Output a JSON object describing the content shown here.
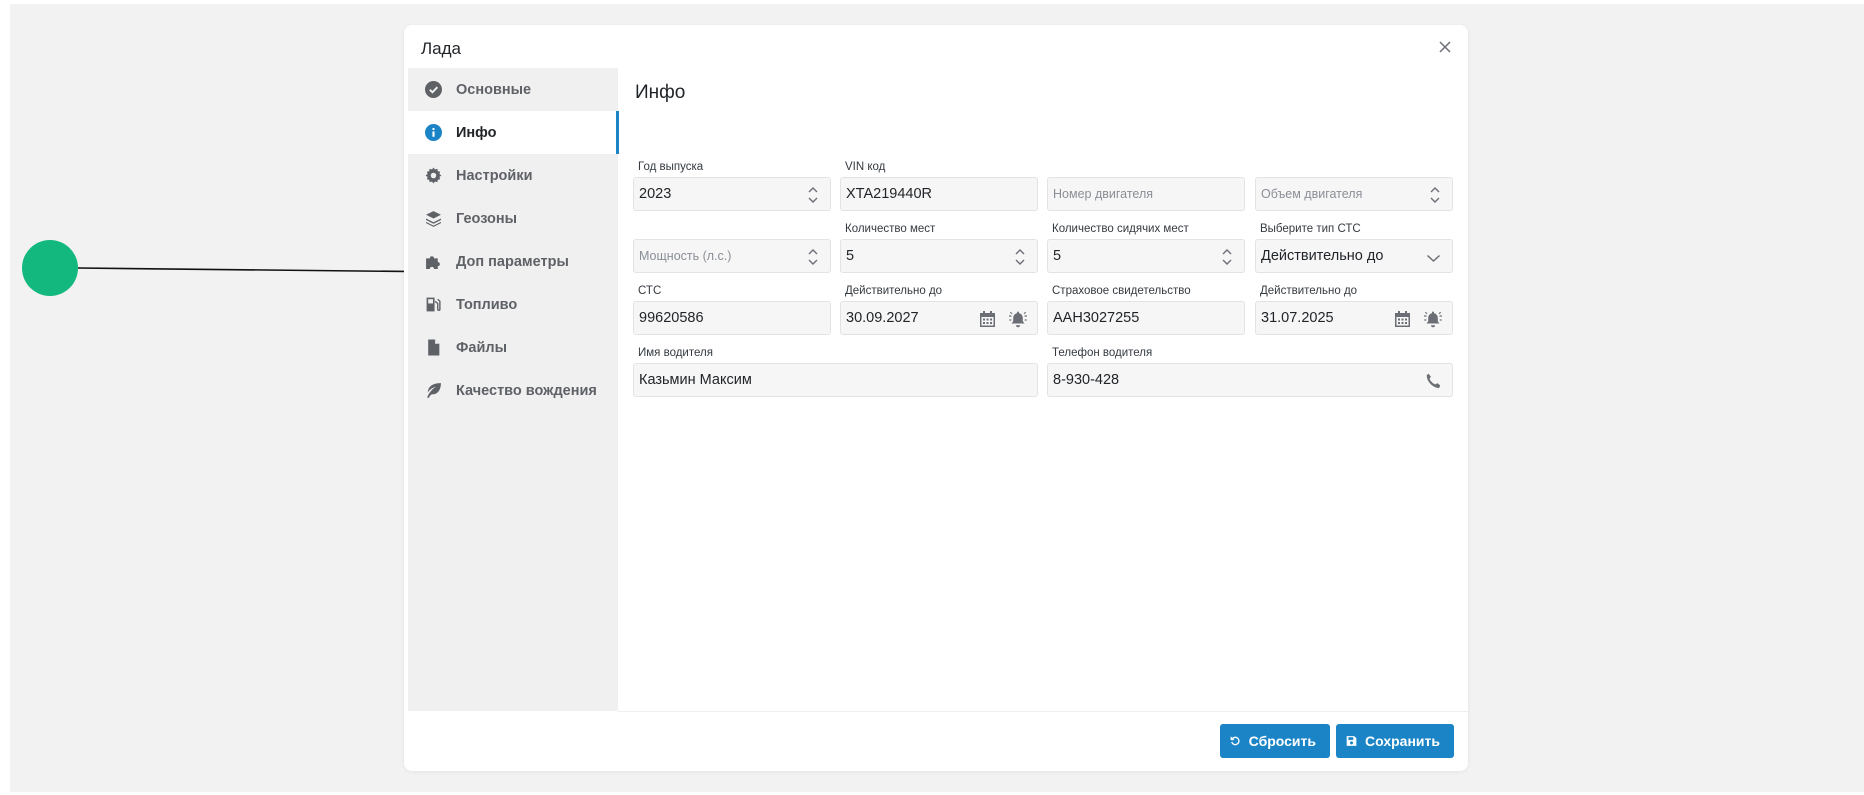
{
  "modal": {
    "title": "Лада"
  },
  "sidebar": {
    "items": [
      {
        "label": "Основные",
        "icon": "check-circle-icon"
      },
      {
        "label": "Инфо",
        "icon": "info-circle-icon"
      },
      {
        "label": "Настройки",
        "icon": "gear-icon"
      },
      {
        "label": "Геозоны",
        "icon": "layers-icon"
      },
      {
        "label": "Доп параметры",
        "icon": "puzzle-icon"
      },
      {
        "label": "Топливо",
        "icon": "gas-pump-icon"
      },
      {
        "label": "Файлы",
        "icon": "file-icon"
      },
      {
        "label": "Качество вождения",
        "icon": "leaf-icon"
      }
    ],
    "active_index": 1
  },
  "info": {
    "title": "Инфо",
    "year": {
      "label": "Год выпуска",
      "value": "2023"
    },
    "vin": {
      "label": "VIN код",
      "value": "XTA219440R"
    },
    "engine_number": {
      "label": "",
      "placeholder": "Номер двигателя"
    },
    "engine_volume": {
      "label": "",
      "placeholder": "Объем двигателя"
    },
    "power": {
      "label": "",
      "placeholder": "Мощность (л.с.)"
    },
    "seats": {
      "label": "Количество мест",
      "value": "5"
    },
    "seating": {
      "label": "Количество сидячих мест",
      "value": "5"
    },
    "sts_type": {
      "label": "Выберите тип СТС",
      "value": "Действительно до"
    },
    "sts": {
      "label": "СТС",
      "value": "99620586"
    },
    "sts_valid": {
      "label": "Действительно до",
      "value": "30.09.2027"
    },
    "insurance": {
      "label": "Страховое свидетельство",
      "value": "ААН3027255"
    },
    "insurance_valid": {
      "label": "Действительно до",
      "value": "31.07.2025"
    },
    "driver_name": {
      "label": "Имя водителя",
      "value": "Казьмин Максим"
    },
    "driver_phone": {
      "label": "Телефон водителя",
      "value": "8-930-428"
    }
  },
  "footer": {
    "reset_label": "Сбросить",
    "save_label": "Сохранить"
  },
  "colors": {
    "accent": "#1b84c7",
    "annotation_dot": "#13b87f"
  }
}
